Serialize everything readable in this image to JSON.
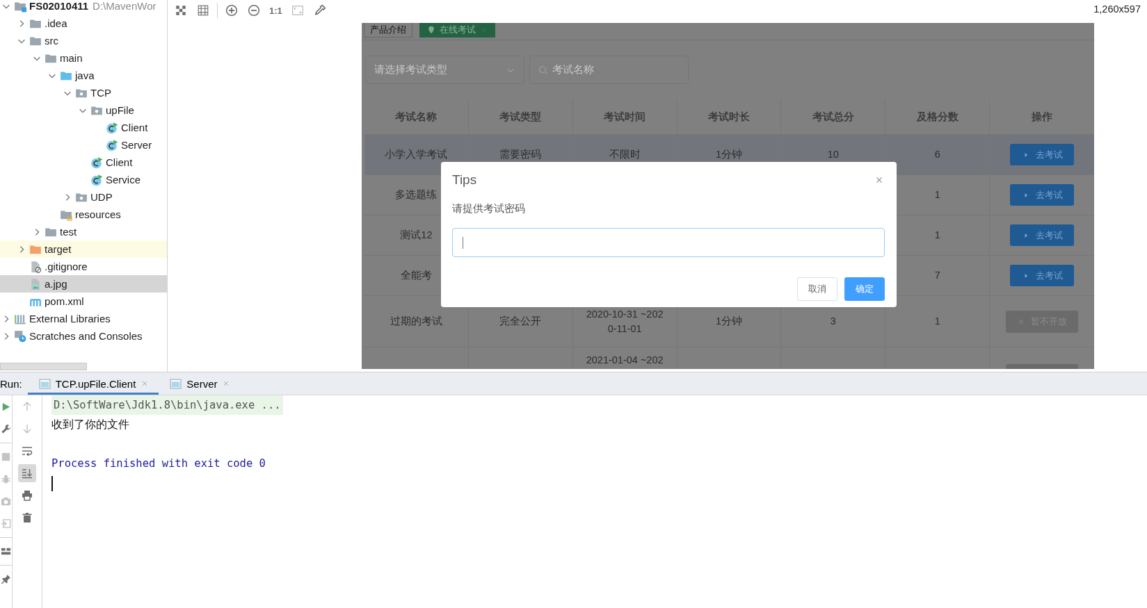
{
  "project_tree": {
    "items": [
      {
        "label": "FS02010411",
        "path": "D:\\MavenWor",
        "kind": "module",
        "expanded": true,
        "selected": false,
        "children": [
          {
            "label": ".idea",
            "kind": "folder",
            "expanded": false,
            "selected": false
          },
          {
            "label": "src",
            "kind": "folder",
            "expanded": true,
            "selected": false,
            "children": [
              {
                "label": "main",
                "kind": "folder",
                "expanded": true,
                "selected": false,
                "children": [
                  {
                    "label": "java",
                    "kind": "source-folder",
                    "expanded": true,
                    "selected": false,
                    "children": [
                      {
                        "label": "TCP",
                        "kind": "package",
                        "expanded": true,
                        "selected": false,
                        "children": [
                          {
                            "label": "upFile",
                            "kind": "package",
                            "expanded": true,
                            "selected": false,
                            "children": [
                              {
                                "label": "Client",
                                "kind": "class",
                                "selected": false
                              },
                              {
                                "label": "Server",
                                "kind": "class",
                                "selected": false
                              }
                            ]
                          },
                          {
                            "label": "Client",
                            "kind": "class",
                            "selected": false
                          },
                          {
                            "label": "Service",
                            "kind": "class",
                            "selected": false
                          }
                        ]
                      },
                      {
                        "label": "UDP",
                        "kind": "package",
                        "expanded": false,
                        "selected": false
                      }
                    ]
                  },
                  {
                    "label": "resources",
                    "kind": "resources-folder",
                    "selected": false
                  }
                ]
              },
              {
                "label": "test",
                "kind": "folder",
                "expanded": false,
                "selected": false
              }
            ]
          },
          {
            "label": "target",
            "kind": "excluded-folder",
            "expanded": false,
            "selected": false
          },
          {
            "label": ".gitignore",
            "kind": "ignore-file",
            "selected": false
          },
          {
            "label": "a.jpg",
            "kind": "image-file",
            "selected": true
          },
          {
            "label": "pom.xml",
            "kind": "maven-file",
            "selected": false
          }
        ]
      },
      {
        "label": "External Libraries",
        "kind": "libraries",
        "expanded": false,
        "selected": false
      },
      {
        "label": "Scratches and Consoles",
        "kind": "scratches",
        "expanded": false,
        "selected": false
      }
    ]
  },
  "image_viewer": {
    "toolbar": [
      {
        "kind": "checkerboard",
        "disabled": false
      },
      {
        "kind": "grid",
        "disabled": false
      },
      {
        "kind": "zoom-in",
        "disabled": false
      },
      {
        "kind": "zoom-out",
        "disabled": false
      },
      {
        "kind": "actual-size",
        "label": "1:1",
        "disabled": false
      },
      {
        "kind": "fit",
        "disabled": true
      },
      {
        "kind": "color-picker",
        "disabled": false
      }
    ],
    "image_size": "1,260x597",
    "page": {
      "tabs": [
        {
          "label": "产品介绍",
          "selected": false
        },
        {
          "label": "在线考试",
          "selected": true
        }
      ],
      "type_select": {
        "placeholder": "请选择考试类型"
      },
      "name_search": {
        "placeholder": "考试名称"
      },
      "table": {
        "columns": [
          "考试名称",
          "考试类型",
          "考试时间",
          "考试时长",
          "考试总分",
          "及格分数",
          "操作"
        ],
        "rows": [
          {
            "highlighted": true,
            "exam_name": "小学入学考试",
            "exam_type": "需要密码",
            "exam_time": [
              "不限时"
            ],
            "duration": "1分钟",
            "total_score": "10",
            "pass_score": "6",
            "action": {
              "label": "去考试",
              "disabled": false
            }
          },
          {
            "highlighted": false,
            "exam_name": "多选题练",
            "pass_score": "1",
            "action": {
              "label": "去考试",
              "disabled": false
            }
          },
          {
            "highlighted": false,
            "exam_name": "测试12",
            "pass_score": "1",
            "action": {
              "label": "去考试",
              "disabled": false
            }
          },
          {
            "highlighted": false,
            "exam_name": "全能考",
            "pass_score": "7",
            "action": {
              "label": "去考试",
              "disabled": false
            }
          },
          {
            "highlighted": false,
            "exam_name": "过期的考试",
            "exam_type": "完全公开",
            "exam_time": [
              "2020-10-31 ~202",
              "0-11-01"
            ],
            "duration": "1分钟",
            "total_score": "3",
            "pass_score": "1",
            "action": {
              "label": "暂不开放",
              "disabled": true
            }
          },
          {
            "highlighted": false,
            "exam_time": [
              "2021-01-04 ~202"
            ],
            "action": {
              "disabled": true
            }
          }
        ]
      },
      "dialog": {
        "title": "Tips",
        "message": "请提供考试密码",
        "input": {
          "focused": true
        },
        "buttons": [
          {
            "label": "取消",
            "primary": false
          },
          {
            "label": "确定",
            "primary": true
          }
        ]
      }
    }
  },
  "run_panel": {
    "label": "Run:",
    "tabs": [
      {
        "label": "TCP.upFile.Client",
        "selected": true
      },
      {
        "label": "Server",
        "selected": false
      }
    ],
    "side_tools": [
      {
        "kind": "rerun",
        "disabled": false
      },
      {
        "kind": "wrench",
        "disabled": false
      },
      {
        "kind": "stop",
        "disabled": true
      },
      {
        "kind": "debug",
        "disabled": true
      },
      {
        "kind": "camera",
        "disabled": true
      },
      {
        "kind": "exit",
        "disabled": true
      },
      {
        "kind": "layout",
        "disabled": false
      },
      {
        "kind": "pin",
        "disabled": false
      }
    ],
    "console_tools": [
      {
        "kind": "up",
        "disabled": true,
        "on": false
      },
      {
        "kind": "down",
        "disabled": true,
        "on": false
      },
      {
        "kind": "wrap",
        "disabled": false,
        "on": false
      },
      {
        "kind": "scroll-end",
        "disabled": false,
        "on": true
      },
      {
        "kind": "print",
        "disabled": false,
        "on": false
      },
      {
        "kind": "trash",
        "disabled": false,
        "on": false
      }
    ],
    "lines": [
      {
        "kind": "command",
        "text": "D:\\SoftWare\\Jdk1.8\\bin\\java.exe ..."
      },
      {
        "kind": "output",
        "text": "收到了你的文件"
      },
      {
        "kind": "blank"
      },
      {
        "kind": "system",
        "text": "Process finished with exit code 0"
      },
      {
        "kind": "cursor"
      }
    ]
  }
}
